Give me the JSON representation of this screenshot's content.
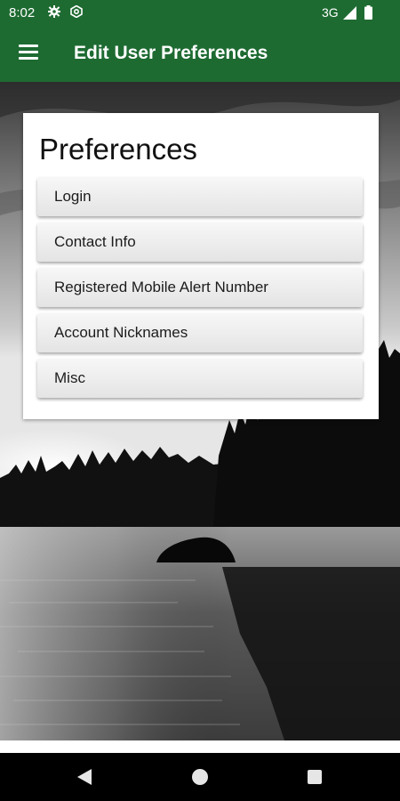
{
  "status_bar": {
    "time": "8:02",
    "network": "3G",
    "icons": [
      "settings-gear-icon",
      "hex-settings-icon",
      "signal-icon",
      "battery-icon"
    ]
  },
  "app_bar": {
    "title": "Edit User Preferences",
    "menu_icon": "hamburger-menu-icon",
    "color": "#1e6b32"
  },
  "card": {
    "title": "Preferences",
    "buttons": [
      {
        "label": "Login"
      },
      {
        "label": "Contact Info"
      },
      {
        "label": "Registered Mobile Alert Number"
      },
      {
        "label": "Account Nicknames"
      },
      {
        "label": "Misc"
      }
    ]
  },
  "background": {
    "description_icon": "lake-sunset-background-image"
  },
  "nav_bar": {
    "icons": [
      "back-icon",
      "home-icon",
      "recents-icon"
    ]
  }
}
